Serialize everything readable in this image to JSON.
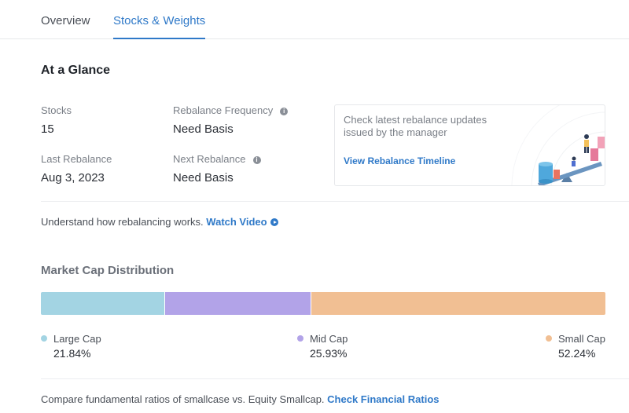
{
  "tabs": [
    {
      "label": "Overview",
      "active": false
    },
    {
      "label": "Stocks & Weights",
      "active": true
    }
  ],
  "at_a_glance": {
    "title": "At a Glance",
    "stocks": {
      "label": "Stocks",
      "value": "15"
    },
    "rebalance_frequency": {
      "label": "Rebalance Frequency",
      "value": "Need Basis"
    },
    "last_rebalance": {
      "label": "Last Rebalance",
      "value": "Aug 3, 2023"
    },
    "next_rebalance": {
      "label": "Next Rebalance",
      "value": "Need Basis"
    }
  },
  "rebalance_card": {
    "text": "Check latest rebalance updates issued by the manager",
    "link": "View Rebalance Timeline"
  },
  "understand": {
    "text": "Understand how rebalancing works.",
    "link": "Watch Video"
  },
  "market_cap": {
    "title": "Market Cap Distribution",
    "segments": [
      {
        "name": "Large Cap",
        "value": "21.84%",
        "pct": 21.84,
        "color": "#a3d4e3"
      },
      {
        "name": "Mid Cap",
        "value": "25.93%",
        "pct": 25.93,
        "color": "#b2a3e8"
      },
      {
        "name": "Small Cap",
        "value": "52.24%",
        "pct": 52.24,
        "color": "#f1bf93"
      }
    ]
  },
  "compare": {
    "text": "Compare fundamental ratios of smallcase vs. Equity Smallcap.",
    "link": "Check Financial Ratios"
  },
  "colors": {
    "accent": "#2f79c8"
  }
}
